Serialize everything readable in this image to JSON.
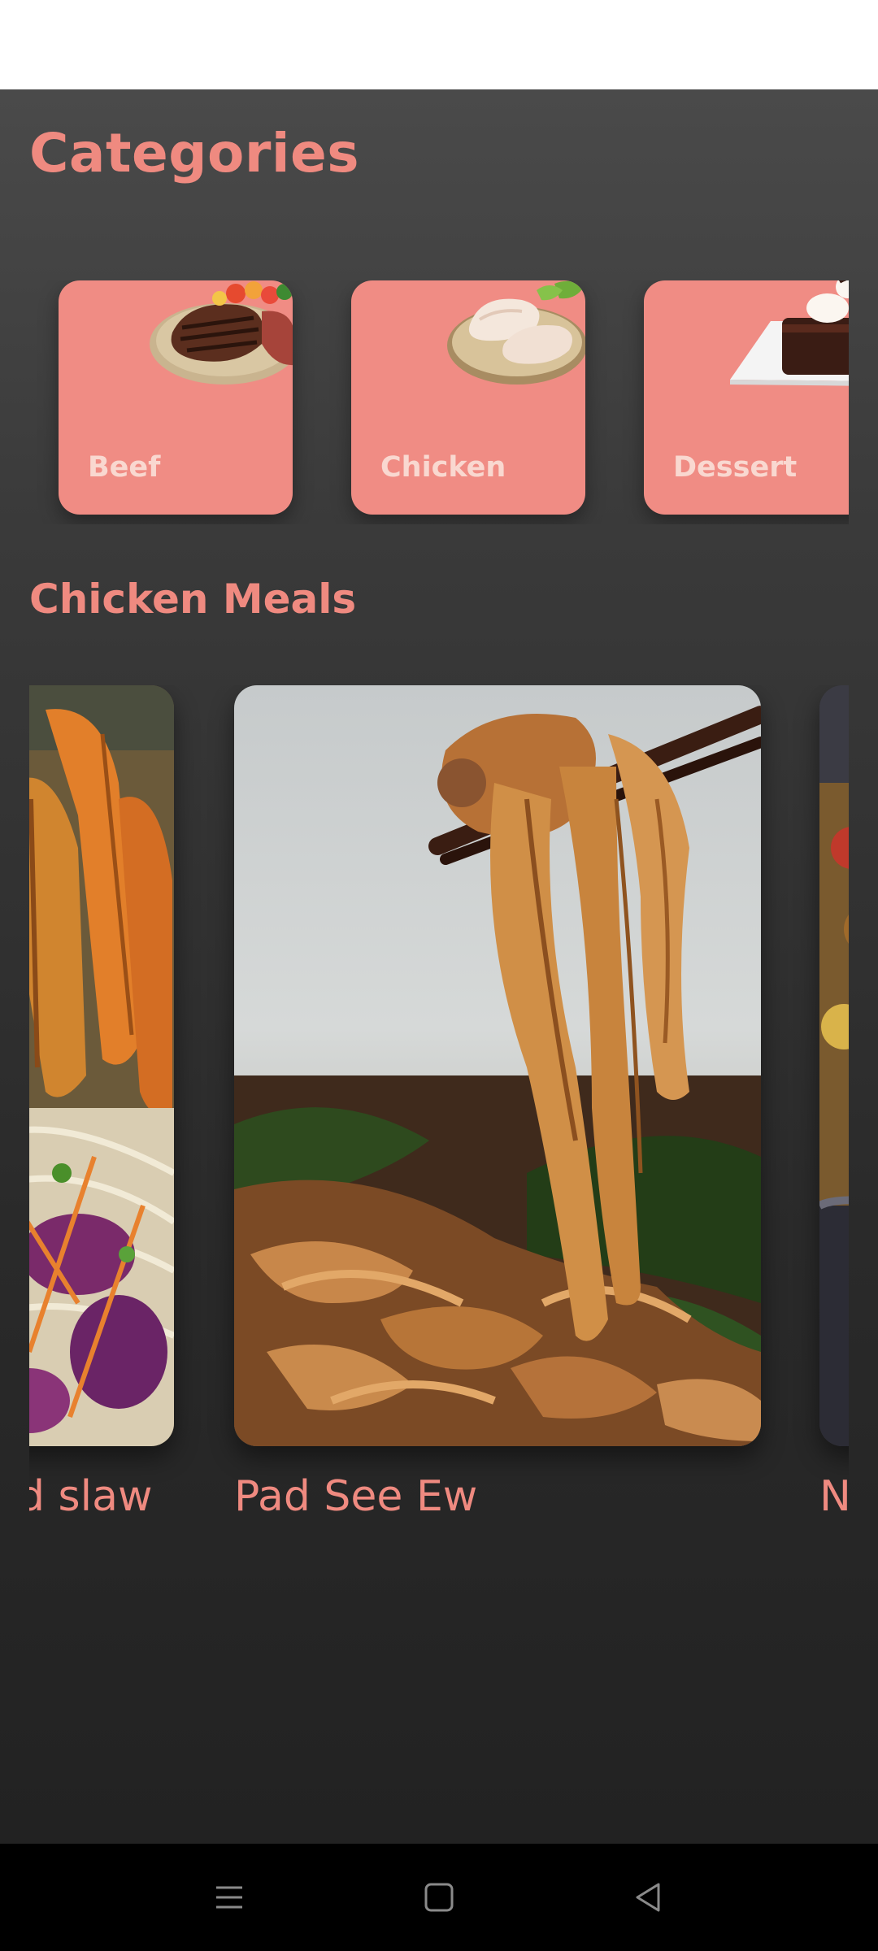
{
  "categories_section": {
    "title": "Categories"
  },
  "categories": [
    {
      "label": "Beef",
      "image": "beef-steak-image"
    },
    {
      "label": "Chicken",
      "image": "chicken-legs-image"
    },
    {
      "label": "Dessert",
      "image": "chocolate-cake-image"
    }
  ],
  "meals_section": {
    "title": "Chicken Meals"
  },
  "meals": [
    {
      "caption": "d slaw",
      "image": "sweet-potato-wedges-slaw-image"
    },
    {
      "caption": "Pad See Ew",
      "image": "pad-see-ew-noodles-image"
    },
    {
      "caption": "N",
      "image": "chicken-curry-image"
    }
  ],
  "nav": {
    "buttons": [
      "menu-icon",
      "home-square-icon",
      "back-triangle-icon"
    ]
  },
  "colors": {
    "accent": "#ef8a80",
    "card": "#f08c84",
    "card_label": "#f9d8d0",
    "background_top": "#4a4a4a",
    "background_bottom": "#222222",
    "nav_bar": "#000000"
  }
}
